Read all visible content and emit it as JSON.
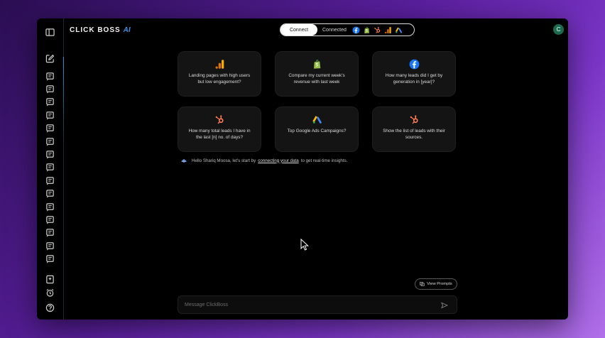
{
  "colors": {
    "accent_blue": "#3d8fe0",
    "sidebar_accent": "#1d9bd6",
    "avatar_bg": "#1d6b4f"
  },
  "app": {
    "logo_text": "CLICK BOSS",
    "logo_ai": "AI"
  },
  "header": {
    "tab_connect": "Connect",
    "tab_connected": "Connected",
    "integrations": [
      "facebook-icon",
      "shopify-icon",
      "hubspot-icon",
      "google-analytics-icon",
      "google-ads-icon"
    ],
    "avatar_initial": "C"
  },
  "sidebar": {
    "top_icons": [
      "panel-toggle-icon",
      "new-chat-icon"
    ],
    "chat_count_icons": 15,
    "bottom_icons": [
      "bookmark-icon",
      "alarm-icon",
      "help-icon"
    ]
  },
  "prompt_cards": [
    {
      "icon": "google-analytics-icon",
      "text": "Landing pages with high users but low engagement?"
    },
    {
      "icon": "shopify-icon",
      "text": "Compare my current week's revenue with last week"
    },
    {
      "icon": "facebook-icon",
      "text": "How many leads did I get by generation in [year]?"
    },
    {
      "icon": "hubspot-icon",
      "text": "How many total leads I have in the last [n] no. of days?"
    },
    {
      "icon": "google-ads-icon",
      "text": "Top Google Ads Campaigns?"
    },
    {
      "icon": "hubspot-icon",
      "text": "Show the list of leads with their sources."
    }
  ],
  "greeting": {
    "before": "Hello Shariq Moosa, let's start by",
    "link": "connecting your data",
    "after": "to get real-time insights."
  },
  "view_prompts_label": "View Prompts",
  "composer": {
    "placeholder": "Message ClickBoss"
  }
}
